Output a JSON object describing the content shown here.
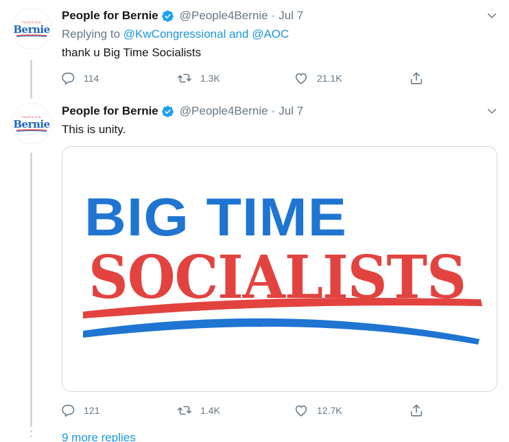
{
  "tweets": [
    {
      "display_name": "People for Bernie",
      "handle": "@People4Bernie",
      "separator": "·",
      "date": "Jul 7",
      "reply_prefix": "Replying to",
      "reply_mention_1": "@KwCongressional",
      "reply_and": "and",
      "reply_mention_2": "@AOC",
      "text": "thank u Big Time Socialists",
      "reply_count": "114",
      "retweet_count": "1.3K",
      "like_count": "21.1K",
      "avatar": {
        "small_text": "PEOPLE FOR",
        "name": "Bernie"
      }
    },
    {
      "display_name": "People for Bernie",
      "handle": "@People4Bernie",
      "separator": "·",
      "date": "Jul 7",
      "text": "This is unity.",
      "reply_count": "121",
      "retweet_count": "1.4K",
      "like_count": "12.7K",
      "avatar": {
        "small_text": "PEOPLE FOR",
        "name": "Bernie"
      },
      "media": {
        "line1": "BIG TIME",
        "line2": "SOCIALISTS"
      }
    }
  ],
  "more_replies": "9 more replies",
  "icons": {
    "verified": "verified-badge-icon",
    "chevron": "chevron-down-icon",
    "reply": "reply-icon",
    "retweet": "retweet-icon",
    "like": "heart-icon",
    "share": "share-icon"
  },
  "colors": {
    "link": "#1b95e0",
    "muted": "#657786",
    "text": "#14171a",
    "logo_blue": "#1f75d1",
    "logo_red": "#e2433f"
  }
}
